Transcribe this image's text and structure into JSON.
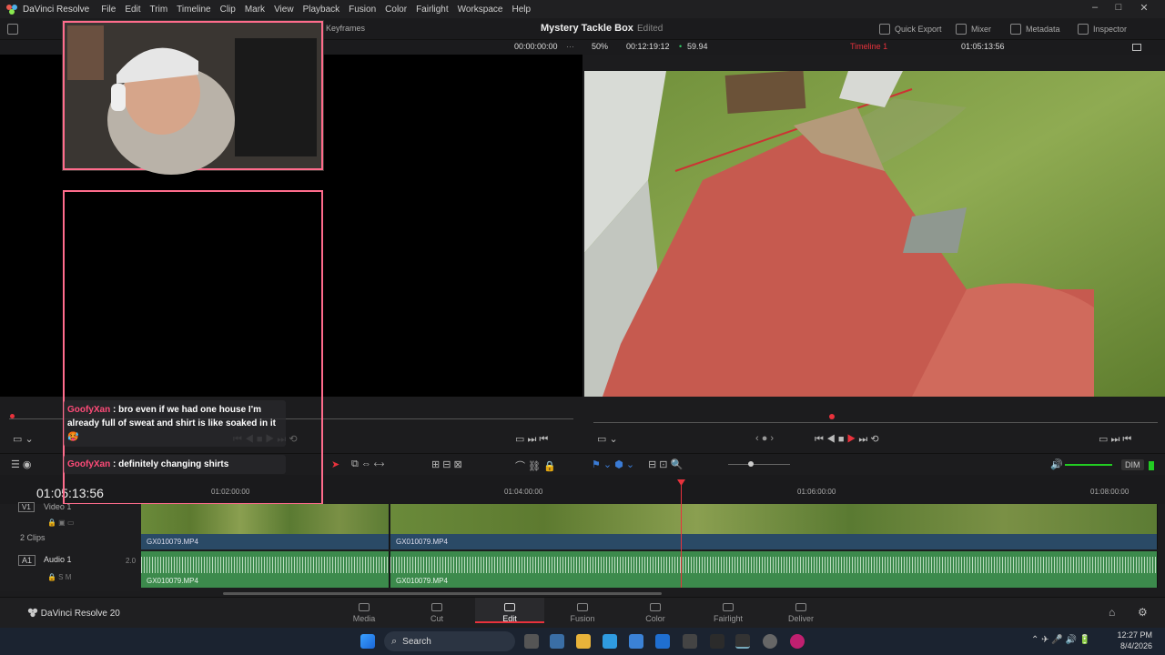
{
  "menubar": {
    "app_title": "DaVinci Resolve",
    "items": [
      "File",
      "Edit",
      "Trim",
      "Timeline",
      "Clip",
      "Mark",
      "View",
      "Playback",
      "Fusion",
      "Color",
      "Fairlight",
      "Workspace",
      "Help"
    ],
    "controls": [
      "–",
      "□",
      "✕"
    ]
  },
  "toolbar": {
    "keyframes_label": "Keyframes",
    "project_title": "Mystery Tackle Box",
    "project_status": "Edited",
    "quick_export": "Quick Export",
    "mixer": "Mixer",
    "metadata": "Metadata",
    "inspector": "Inspector"
  },
  "viewer": {
    "source_timecode": "00:00:00:00",
    "zoom": "50%",
    "duration": "00:12:19:12",
    "fps": "59.94",
    "timeline_name": "Timeline 1",
    "record_timecode": "01:05:13:56"
  },
  "timeline": {
    "timecode": "01:05:13:56",
    "ruler": [
      "01:02:00:00",
      "01:04:00:00",
      "01:06:00:00",
      "01:08:00:00"
    ],
    "video_track": {
      "id": "V1",
      "name": "Video 1",
      "clip_count": "2 Clips"
    },
    "audio_track": {
      "id": "A1",
      "name": "Audio 1",
      "level": "2.0"
    },
    "clips": [
      "GX010079.MP4",
      "GX010079.MP4"
    ],
    "dim_label": "DIM"
  },
  "chat": [
    {
      "user": "GoofyXan",
      "message": ": bro even if we had one house I'm already full of sweat and shirt is like soaked in it🥵"
    },
    {
      "user": "GoofyXan",
      "message": ": definitely changing shirts"
    }
  ],
  "pages": {
    "brand": "DaVinci Resolve 20",
    "tabs": [
      "Media",
      "Cut",
      "Edit",
      "Fusion",
      "Color",
      "Fairlight",
      "Deliver"
    ],
    "active": "Edit"
  },
  "taskbar": {
    "search_placeholder": "Search",
    "time": "12:27 PM",
    "date": "8/4/2026"
  },
  "colors": {
    "accent_red": "#e8323c",
    "chat_user": "#ff4b78",
    "video_clip": "#2a4a66",
    "audio_clip": "#3c8a4c"
  }
}
